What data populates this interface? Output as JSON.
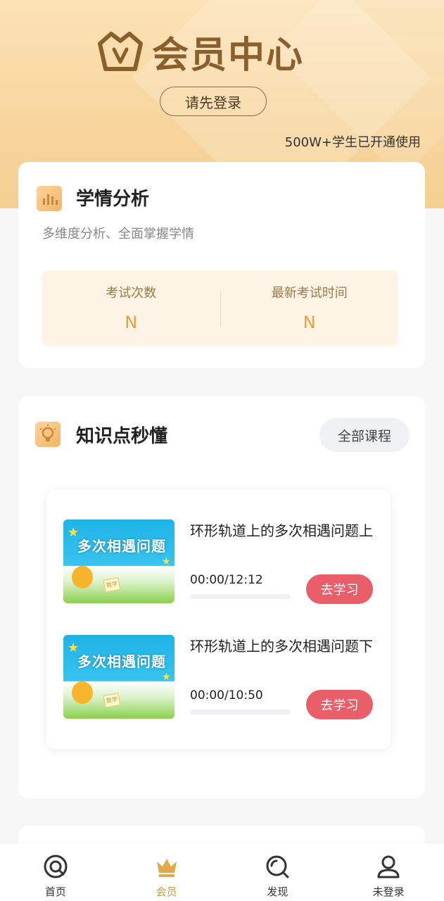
{
  "header": {
    "title": "会员中心",
    "login_button": "请先登录",
    "user_count": "500W+学生已开通使用"
  },
  "analysis": {
    "title": "学情分析",
    "subtitle": "多维度分析、全面掌握学情",
    "stats": [
      {
        "label": "考试次数",
        "value": "N"
      },
      {
        "label": "最新考试时间",
        "value": "N"
      }
    ]
  },
  "knowledge": {
    "title": "知识点秒懂",
    "all_courses": "全部课程",
    "courses": [
      {
        "thumb_title": "多次相遇问题",
        "thumb_book": "数学",
        "name": "环形轨道上的多次相遇问题上",
        "time": "00:00/12:12",
        "progress": 0,
        "button": "去学习"
      },
      {
        "thumb_title": "多次相遇问题",
        "thumb_book": "数学",
        "name": "环形轨道上的多次相遇问题下",
        "time": "00:00/10:50",
        "progress": 0,
        "button": "去学习"
      }
    ]
  },
  "tabbar": {
    "items": [
      {
        "label": "首页",
        "icon": "home-icon",
        "active": false
      },
      {
        "label": "会员",
        "icon": "crown-icon",
        "active": true
      },
      {
        "label": "发现",
        "icon": "discover-icon",
        "active": false
      },
      {
        "label": "未登录",
        "icon": "user-icon",
        "active": false
      }
    ]
  },
  "colors": {
    "accent": "#d49a3a",
    "button_red": "#ea5e6a",
    "header_gold": "#f7d59d",
    "title_brown": "#8a5f2c"
  }
}
